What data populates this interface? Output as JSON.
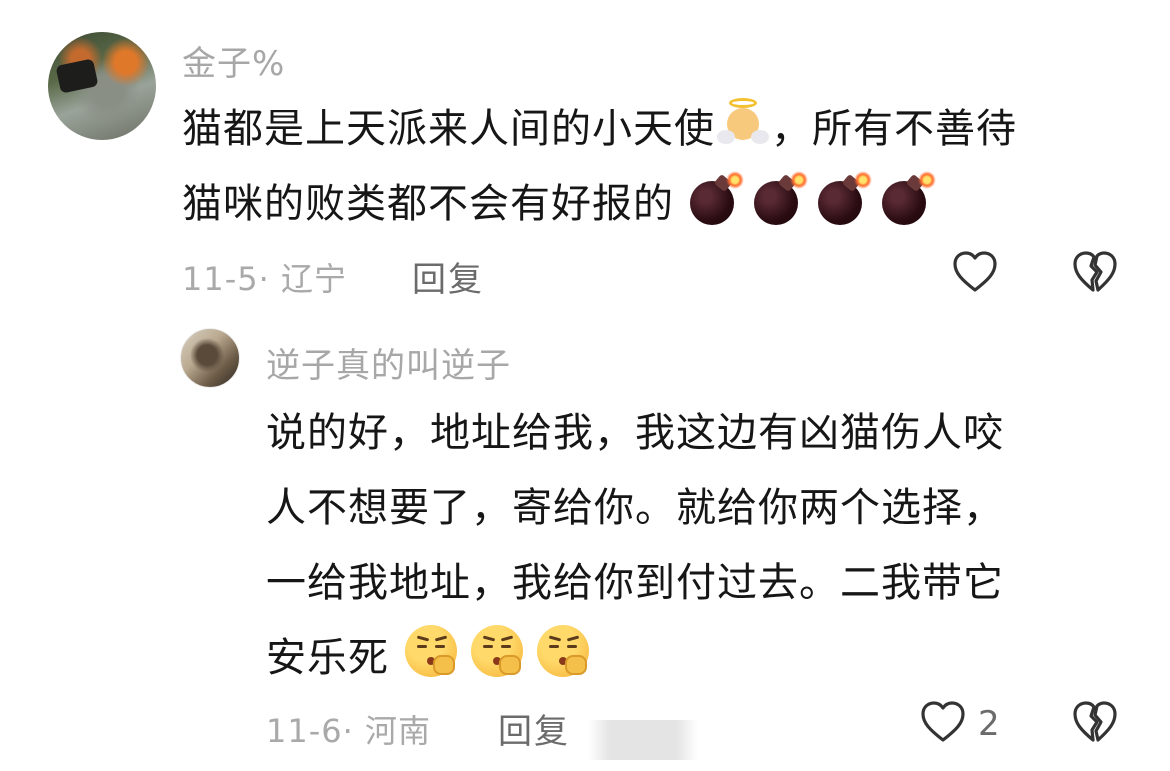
{
  "comments": [
    {
      "username": "金子%",
      "lines": [
        "猫都是上天派来人间的小天使",
        "，所有不善待",
        "猫咪的败类都不会有好报的"
      ],
      "emojis": [
        "angel-emoji",
        "bomb-emoji"
      ],
      "date_location": "11-5· 辽宁",
      "reply_label": "回复"
    },
    {
      "username": "逆子真的叫逆子",
      "lines": [
        "说的好，地址给我，我这边有凶猫伤人咬",
        "人不想要了，寄给你。就给你两个选择，",
        "一给我地址，我给你到付过去。二我带它",
        "安乐死"
      ],
      "emojis": [
        "shushing-face-emoji"
      ],
      "date_location": "11-6· 河南",
      "reply_label": "回复",
      "like_count": "2"
    }
  ]
}
